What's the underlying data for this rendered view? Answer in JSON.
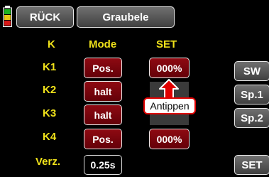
{
  "header": {
    "back_label": "RÜCK",
    "title": "Graubele"
  },
  "columns": {
    "k": "K",
    "mode": "Mode",
    "set": "SET"
  },
  "rows": [
    {
      "k": "K1",
      "mode": "Pos.",
      "set": "000%"
    },
    {
      "k": "K2",
      "mode": "halt"
    },
    {
      "k": "K3",
      "mode": "halt"
    },
    {
      "k": "K4",
      "mode": "Pos.",
      "set": "000%"
    },
    {
      "k": "Verz.",
      "mode": "0.25s"
    }
  ],
  "side_buttons": {
    "sw": "SW",
    "sp1": "Sp.1",
    "sp2": "Sp.2",
    "set": "SET"
  },
  "callout": "Antippen",
  "icons": {
    "battery": "battery-icon",
    "arrow": "up-arrow-icon"
  },
  "colors": {
    "label_yellow": "#f0e21a",
    "button_red": "#7a0810",
    "arrow_red": "#e00000"
  }
}
